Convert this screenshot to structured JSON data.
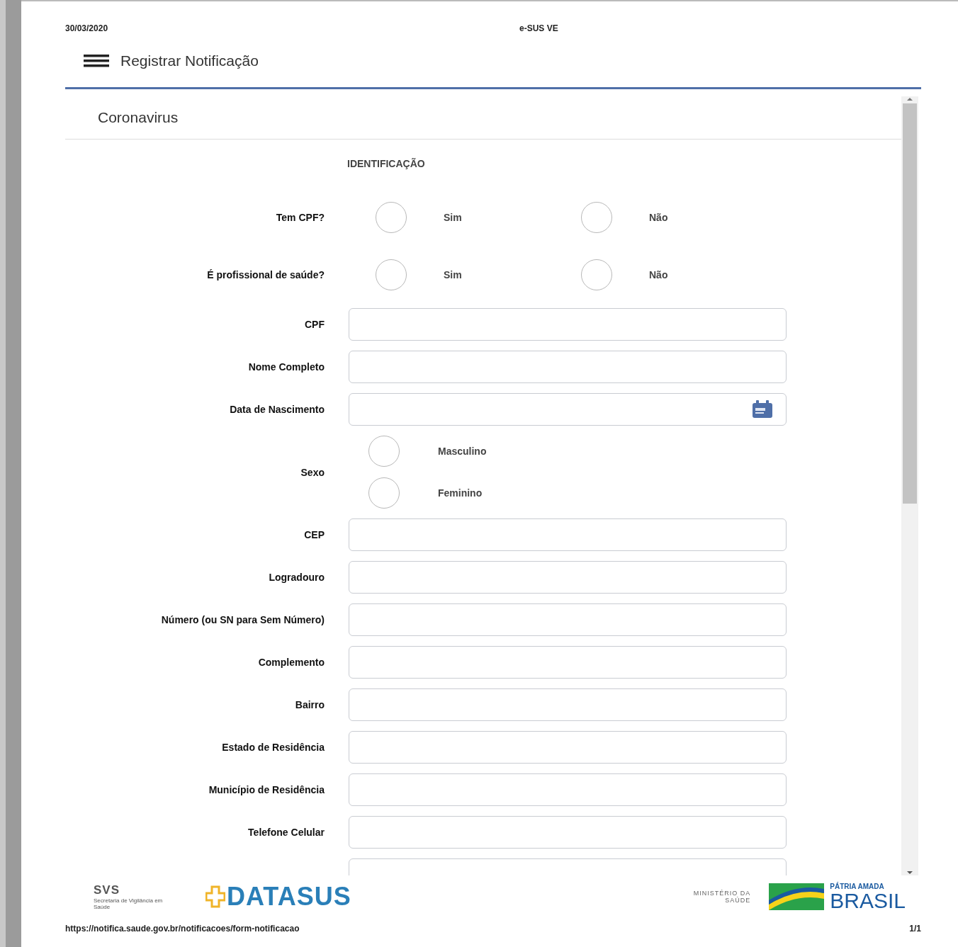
{
  "header": {
    "date": "30/03/2020",
    "title": "e-SUS VE"
  },
  "app_bar": {
    "title": "Registrar Notificação"
  },
  "form": {
    "title": "Coronavirus",
    "section": "IDENTIFICAÇÃO",
    "rows": [
      {
        "kind": "radio",
        "label": "Tem CPF?",
        "options": [
          {
            "label": "Sim",
            "selected": false
          },
          {
            "label": "Não",
            "selected": false
          }
        ]
      },
      {
        "kind": "radio",
        "label": "É profissional de saúde?",
        "options": [
          {
            "label": "Sim",
            "selected": false
          },
          {
            "label": "Não",
            "selected": false
          }
        ]
      },
      {
        "kind": "text",
        "label": "CPF"
      },
      {
        "kind": "text",
        "label": "Nome Completo"
      },
      {
        "kind": "date",
        "label": "Data de Nascimento"
      },
      {
        "kind": "radio_stack",
        "label": "Sexo",
        "options": [
          {
            "label": "Masculino",
            "selected": false
          },
          {
            "label": "Feminino",
            "selected": false
          }
        ]
      },
      {
        "kind": "text",
        "label": "CEP"
      },
      {
        "kind": "text",
        "label": "Logradouro"
      },
      {
        "kind": "text",
        "label": "Número (ou SN para Sem Número)"
      },
      {
        "kind": "text",
        "label": "Complemento"
      },
      {
        "kind": "text",
        "label": "Bairro"
      },
      {
        "kind": "text",
        "label": "Estado de Residência"
      },
      {
        "kind": "text",
        "label": "Município de Residência"
      },
      {
        "kind": "text",
        "label": "Telefone Celular"
      },
      {
        "kind": "text"
      }
    ]
  },
  "footer": {
    "svs": {
      "acronym": "SVS",
      "name": "Secretaria de Vigilância em Saúde"
    },
    "datasus": "DATASUS",
    "ministry": {
      "line1": "MINISTÉRIO DA",
      "line2": "SAÚDE"
    },
    "brasil": {
      "motto": "PÁTRIA AMADA",
      "name": "BRASIL"
    }
  },
  "print_footer": {
    "url": "https://notifica.saude.gov.br/notificacoes/form-notificacao",
    "page": "1/1"
  }
}
